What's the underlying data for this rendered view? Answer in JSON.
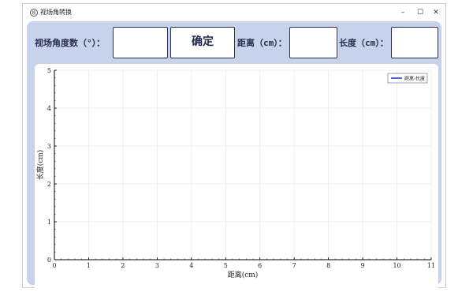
{
  "window": {
    "title": "视场角转换",
    "icon_glyph": "视"
  },
  "controls": {
    "minimize": "–",
    "maximize": "☐",
    "close": "✕"
  },
  "form": {
    "angle_label": "视场角度数（°）：",
    "angle_value": "",
    "confirm_label": "确定",
    "distance_label": "距离（cm）：",
    "distance_value": "",
    "length_label": "长度（cm）：",
    "length_value": ""
  },
  "chart_data": {
    "type": "line",
    "xlabel": "距离(cm)",
    "ylabel": "长度(cm)",
    "xlim": [
      0,
      11
    ],
    "ylim": [
      0,
      5
    ],
    "xticks": [
      "0",
      "1",
      "2",
      "3",
      "4",
      "5",
      "6",
      "7",
      "8",
      "9",
      "10",
      "11"
    ],
    "yticks": [
      "0",
      "1",
      "2",
      "3",
      "4",
      "5"
    ],
    "grid": true,
    "legend_position": "top-right",
    "series": [
      {
        "name": "距离-长度",
        "color": "#1f3fbf",
        "x": [],
        "y": []
      }
    ]
  }
}
